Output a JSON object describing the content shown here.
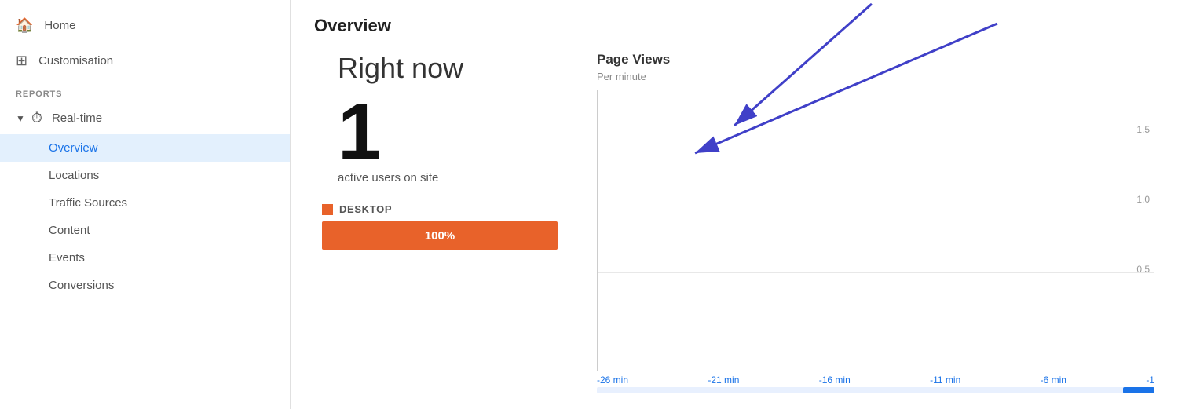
{
  "sidebar": {
    "home_label": "Home",
    "customisation_label": "Customisation",
    "reports_section": "REPORTS",
    "realtime_label": "Real-time",
    "sub_items": [
      {
        "label": "Overview",
        "active": true
      },
      {
        "label": "Locations",
        "active": false
      },
      {
        "label": "Traffic Sources",
        "active": false
      },
      {
        "label": "Content",
        "active": false
      },
      {
        "label": "Events",
        "active": false
      },
      {
        "label": "Conversions",
        "active": false
      }
    ]
  },
  "main": {
    "page_title": "Overview",
    "right_now_label": "Right now",
    "active_users_count": "1",
    "active_users_label": "active users on site",
    "device_name": "DESKTOP",
    "progress_percent": "100%",
    "chart": {
      "title": "Page Views",
      "subtitle": "Per minute",
      "y_labels": [
        "1.5",
        "1.0",
        "0.5"
      ],
      "x_labels": [
        "-26 min",
        "-21 min",
        "-16 min",
        "-11 min",
        "-6 min",
        "-1"
      ]
    }
  }
}
